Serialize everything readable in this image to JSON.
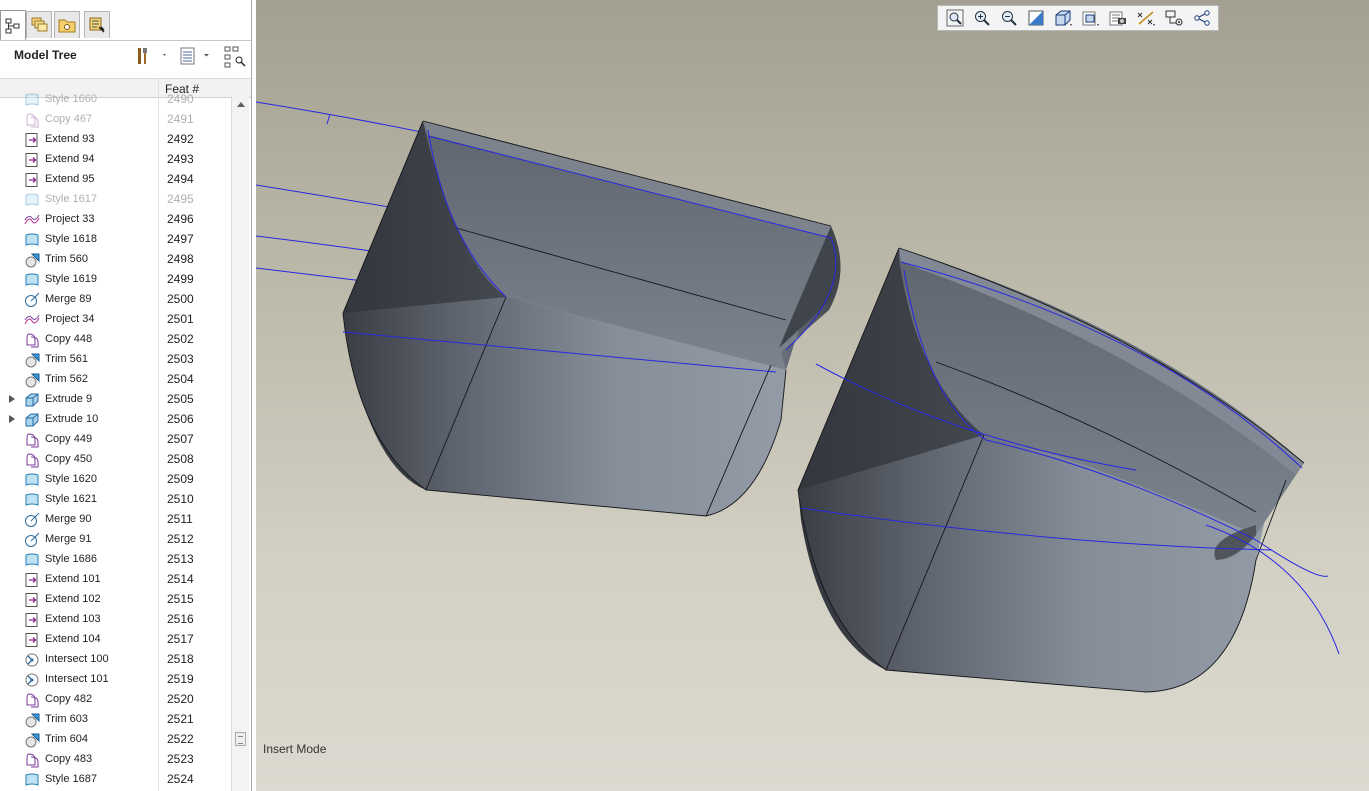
{
  "panel": {
    "title": "Model Tree",
    "column_header": "Feat #"
  },
  "tabs": [
    {
      "icon": "model-tree-icon",
      "active": true
    },
    {
      "icon": "layers-icon",
      "active": false
    },
    {
      "icon": "folder-icon",
      "active": false
    },
    {
      "icon": "favorites-icon",
      "active": false
    }
  ],
  "tree_rows": [
    {
      "name": "Style 1660",
      "feat": "2490",
      "icon": "style-icon",
      "suppressed": true,
      "expandable": false
    },
    {
      "name": "Copy 467",
      "feat": "2491",
      "icon": "copy-icon",
      "suppressed": true,
      "expandable": false
    },
    {
      "name": "Extend 93",
      "feat": "2492",
      "icon": "extend-icon",
      "suppressed": false,
      "expandable": false
    },
    {
      "name": "Extend 94",
      "feat": "2493",
      "icon": "extend-icon",
      "suppressed": false,
      "expandable": false
    },
    {
      "name": "Extend 95",
      "feat": "2494",
      "icon": "extend-icon",
      "suppressed": false,
      "expandable": false
    },
    {
      "name": "Style 1617",
      "feat": "2495",
      "icon": "style-icon",
      "suppressed": true,
      "expandable": false
    },
    {
      "name": "Project 33",
      "feat": "2496",
      "icon": "project-icon",
      "suppressed": false,
      "expandable": false
    },
    {
      "name": "Style 1618",
      "feat": "2497",
      "icon": "style-icon",
      "suppressed": false,
      "expandable": false
    },
    {
      "name": "Trim 560",
      "feat": "2498",
      "icon": "trim-icon",
      "suppressed": false,
      "expandable": false
    },
    {
      "name": "Style 1619",
      "feat": "2499",
      "icon": "style-icon",
      "suppressed": false,
      "expandable": false
    },
    {
      "name": "Merge 89",
      "feat": "2500",
      "icon": "merge-icon",
      "suppressed": false,
      "expandable": false
    },
    {
      "name": "Project 34",
      "feat": "2501",
      "icon": "project-icon",
      "suppressed": false,
      "expandable": false
    },
    {
      "name": "Copy 448",
      "feat": "2502",
      "icon": "copy-icon",
      "suppressed": false,
      "expandable": false
    },
    {
      "name": "Trim 561",
      "feat": "2503",
      "icon": "trim-icon",
      "suppressed": false,
      "expandable": false
    },
    {
      "name": "Trim 562",
      "feat": "2504",
      "icon": "trim-icon",
      "suppressed": false,
      "expandable": false
    },
    {
      "name": "Extrude 9",
      "feat": "2505",
      "icon": "extrude-icon",
      "suppressed": false,
      "expandable": true
    },
    {
      "name": "Extrude 10",
      "feat": "2506",
      "icon": "extrude-icon",
      "suppressed": false,
      "expandable": true
    },
    {
      "name": "Copy 449",
      "feat": "2507",
      "icon": "copy-icon",
      "suppressed": false,
      "expandable": false
    },
    {
      "name": "Copy 450",
      "feat": "2508",
      "icon": "copy-icon",
      "suppressed": false,
      "expandable": false
    },
    {
      "name": "Style 1620",
      "feat": "2509",
      "icon": "style-icon",
      "suppressed": false,
      "expandable": false
    },
    {
      "name": "Style 1621",
      "feat": "2510",
      "icon": "style-icon",
      "suppressed": false,
      "expandable": false
    },
    {
      "name": "Merge 90",
      "feat": "2511",
      "icon": "merge-icon",
      "suppressed": false,
      "expandable": false
    },
    {
      "name": "Merge 91",
      "feat": "2512",
      "icon": "merge-icon",
      "suppressed": false,
      "expandable": false
    },
    {
      "name": "Style 1686",
      "feat": "2513",
      "icon": "style-icon",
      "suppressed": false,
      "expandable": false
    },
    {
      "name": "Extend 101",
      "feat": "2514",
      "icon": "extend-icon",
      "suppressed": false,
      "expandable": false
    },
    {
      "name": "Extend 102",
      "feat": "2515",
      "icon": "extend-icon",
      "suppressed": false,
      "expandable": false
    },
    {
      "name": "Extend 103",
      "feat": "2516",
      "icon": "extend-icon",
      "suppressed": false,
      "expandable": false
    },
    {
      "name": "Extend 104",
      "feat": "2517",
      "icon": "extend-icon",
      "suppressed": false,
      "expandable": false
    },
    {
      "name": "Intersect 100",
      "feat": "2518",
      "icon": "intersect-icon",
      "suppressed": false,
      "expandable": false
    },
    {
      "name": "Intersect 101",
      "feat": "2519",
      "icon": "intersect-icon",
      "suppressed": false,
      "expandable": false
    },
    {
      "name": "Copy 482",
      "feat": "2520",
      "icon": "copy-icon",
      "suppressed": false,
      "expandable": false
    },
    {
      "name": "Trim 603",
      "feat": "2521",
      "icon": "trim-icon",
      "suppressed": false,
      "expandable": false
    },
    {
      "name": "Trim 604",
      "feat": "2522",
      "icon": "trim-icon",
      "suppressed": false,
      "expandable": false
    },
    {
      "name": "Copy 483",
      "feat": "2523",
      "icon": "copy-icon",
      "suppressed": false,
      "expandable": false
    },
    {
      "name": "Style 1687",
      "feat": "2524",
      "icon": "style-icon",
      "suppressed": false,
      "expandable": false
    }
  ],
  "view_toolbar": [
    {
      "name": "refit-icon"
    },
    {
      "name": "zoom-in-icon"
    },
    {
      "name": "zoom-out-icon"
    },
    {
      "name": "repaint-icon"
    },
    {
      "name": "display-style-icon"
    },
    {
      "name": "saved-orientations-icon"
    },
    {
      "name": "view-manager-icon"
    },
    {
      "name": "datum-display-icon"
    },
    {
      "name": "annotation-display-icon"
    },
    {
      "name": "spin-center-icon"
    }
  ],
  "status": {
    "mode": "Insert Mode"
  },
  "colors": {
    "viewport_top": "#a3a091",
    "viewport_bottom": "#dcdad0",
    "curve": "#2a2ae0",
    "surface_dark": "#3c3f46",
    "surface_light": "#8b939e"
  }
}
